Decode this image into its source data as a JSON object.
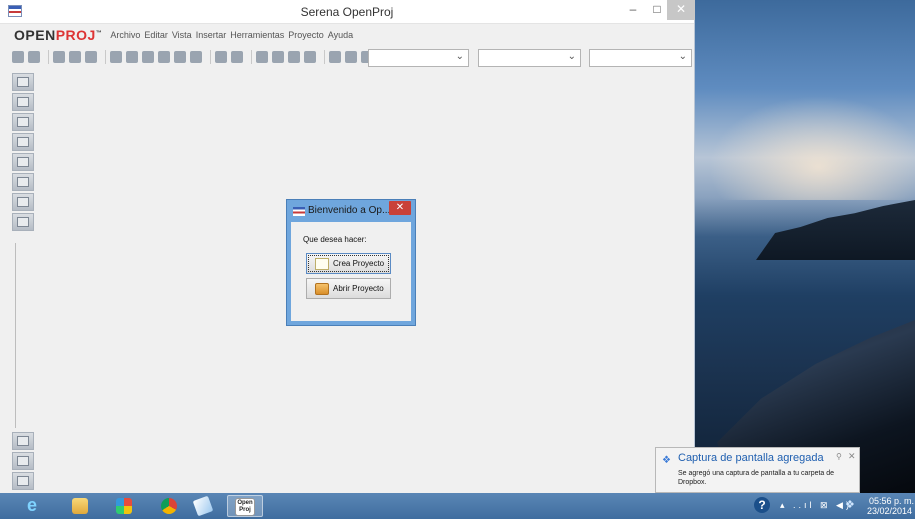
{
  "window": {
    "title": "Serena OpenProj",
    "minimize": "–",
    "maximize": "□",
    "close": "✕"
  },
  "logo": {
    "open": "OPEN",
    "proj": "PROJ",
    "tm": "™"
  },
  "menu": [
    "Archivo",
    "Editar",
    "Vista",
    "Insertar",
    "Herramientas",
    "Proyecto",
    "Ayuda"
  ],
  "toolbar": {
    "combo_chevron": "⌄",
    "icons": [
      "new-icon",
      "open-icon",
      "save-icon",
      "print-icon",
      "print-preview-icon",
      "cut-icon",
      "copy-icon",
      "paste-icon",
      "find-icon",
      "undo-icon",
      "redo-icon",
      "link-icon",
      "unlink-icon",
      "task-info-icon",
      "notes-icon",
      "assign-resources-icon",
      "calendar-icon",
      "zoom-in-icon",
      "zoom-out-icon",
      "filter-icon",
      "scroll-left-icon",
      "scroll-right-icon"
    ]
  },
  "sidebar": {
    "top": [
      "gantt-view-icon",
      "network-view-icon",
      "resources-view-icon",
      "wbs-view-icon",
      "rbs-view-icon",
      "report-view-icon",
      "task-usage-icon",
      "resource-usage-icon"
    ],
    "bottom": [
      "histogram-icon",
      "charts-icon",
      "usage-detail-icon"
    ]
  },
  "dialog": {
    "title": "Bienvenido a Op...",
    "close": "✕",
    "question": "Que desea hacer:",
    "new_project": "Crea Proyecto",
    "open_project": "Abrir Proyecto"
  },
  "notification": {
    "title": "Captura de pantalla agregada",
    "body": "Se agregó una captura de pantalla a tu carpeta de Dropbox.",
    "pin": "⚲",
    "close": "✕"
  },
  "taskbar": {
    "apps": [
      "internet-explorer-icon",
      "file-explorer-icon",
      "app-icon",
      "chrome-icon",
      "app-icon-2",
      "openproj-icon"
    ],
    "openproj_label": "Open Proj",
    "help": "?",
    "tray": "▴ ..ıl ⊠ ◀)",
    "time": "05:56 p. m.",
    "date": "23/02/2014"
  }
}
